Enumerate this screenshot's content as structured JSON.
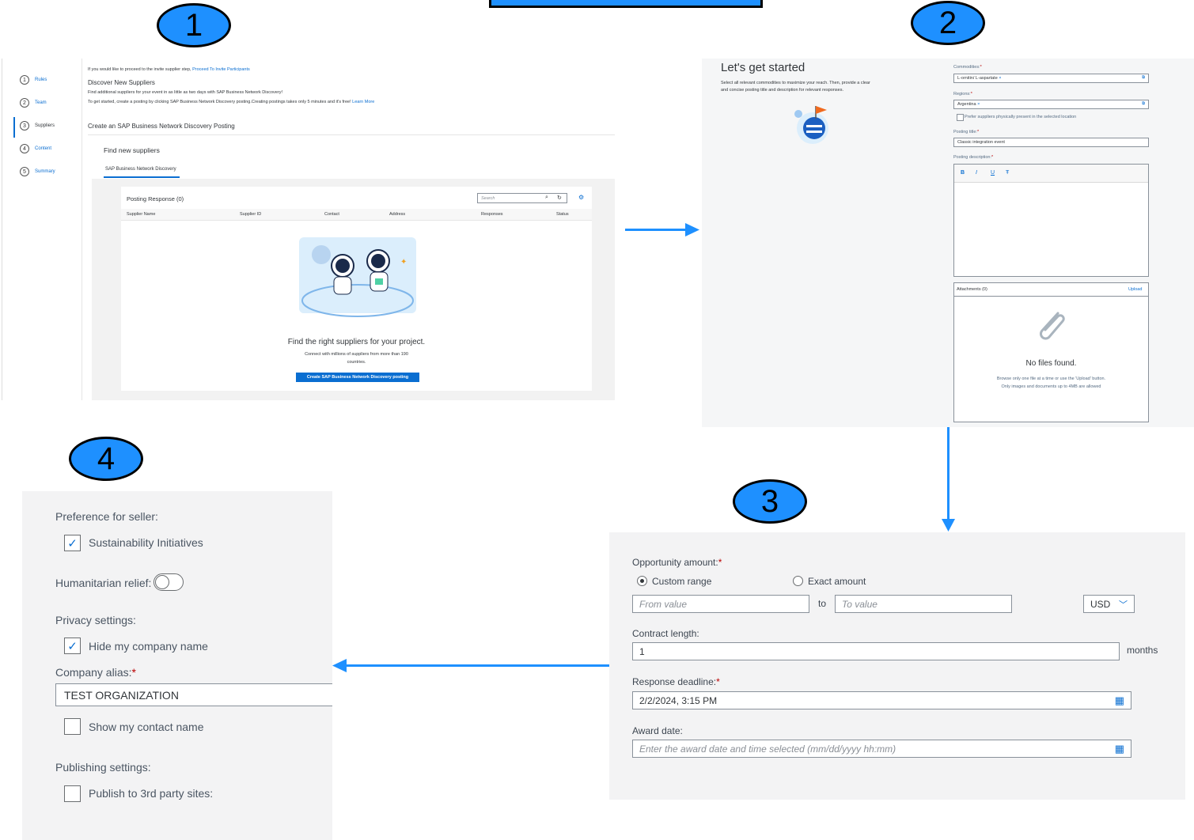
{
  "badges": [
    "1",
    "2",
    "3",
    "4"
  ],
  "panel1": {
    "steps": [
      {
        "num": "1",
        "label": "Rules"
      },
      {
        "num": "2",
        "label": "Team"
      },
      {
        "num": "3",
        "label": "Suppliers"
      },
      {
        "num": "4",
        "label": "Content"
      },
      {
        "num": "5",
        "label": "Summary"
      }
    ],
    "intro_prefix": "If you would like to proceed to the invite supplier step,",
    "intro_link": "Proceed To Invite Participants",
    "discover_title": "Discover New Suppliers",
    "discover_line1": "Find additional suppliers for your event in as little as two days with SAP Business Network Discovery!",
    "discover_line2": "To get started, create a posting by clicking SAP Business Network Discovery posting.Creating postings takes only 5 minutes and it's free!",
    "learn_more": "Learn More",
    "section_title": "Create an SAP Business Network Discovery Posting",
    "find_title": "Find new suppliers",
    "tab_label": "SAP Business Network Discovery",
    "table_title": "Posting Response (0)",
    "search_placeholder": "Search",
    "columns": [
      "Supplier Name",
      "Supplier ID",
      "Contact",
      "Address",
      "Responses",
      "Status"
    ],
    "empty_title": "Find the right suppliers for your project.",
    "empty_line1": "Connect with millions of suppliers from more than 190",
    "empty_line2": "countries.",
    "create_button": "Create SAP Business Network Discovery posting"
  },
  "panel2": {
    "heading": "Let's get started",
    "desc1": "Select all relevant commodities to maximize your reach. Then, provide a clear",
    "desc2": "and concise posting title and description for relevant responses.",
    "commodities_label": "Commodities:",
    "commodities_token": "L-ornitin/ L-aspartate",
    "regions_label": "Regions:",
    "regions_token": "Argentina",
    "prefer_label": "Prefer suppliers physically present in the selected location",
    "title_label": "Posting title:",
    "title_value": "Classic integration event",
    "desc_label": "Posting description:",
    "rte_bold": "B",
    "rte_italic": "I",
    "rte_underline": "U",
    "rte_strike": "Ŧ",
    "attachments_label": "Attachments (0)",
    "upload_label": "Upload",
    "no_files": "No files found.",
    "no_files_hint1": "Browse only one file at a time or use the 'Upload' button.",
    "no_files_hint2": "Only images and documents up to 4MB are allowed"
  },
  "panel3": {
    "amount_label": "Opportunity amount:",
    "custom_range": "Custom range",
    "exact_amount": "Exact amount",
    "from_placeholder": "From value",
    "to_label": "to",
    "to_placeholder": "To value",
    "currency": "USD",
    "contract_label": "Contract length:",
    "contract_value": "1",
    "months": "months",
    "deadline_label": "Response deadline:",
    "deadline_value": "2/2/2024, 3:15 PM",
    "award_label": "Award date:",
    "award_placeholder": "Enter the award date and time selected (mm/dd/yyyy hh:mm)"
  },
  "panel4": {
    "pref_label": "Preference for seller:",
    "sustainability": "Sustainability Initiatives",
    "sustainability_checked": true,
    "humanitarian": "Humanitarian relief:",
    "humanitarian_on": false,
    "privacy_label": "Privacy settings:",
    "hide_company": "Hide my company name",
    "hide_company_checked": true,
    "alias_label": "Company alias:",
    "alias_value": "TEST ORGANIZATION",
    "show_contact": "Show my contact name",
    "show_contact_checked": false,
    "publishing_label": "Publishing settings:",
    "publish_3rd": "Publish to 3rd party sites:",
    "publish_3rd_checked": false
  },
  "colors": {
    "accent": "#1e90ff",
    "sap_blue": "#0a6ed1",
    "required": "#bb0000"
  }
}
